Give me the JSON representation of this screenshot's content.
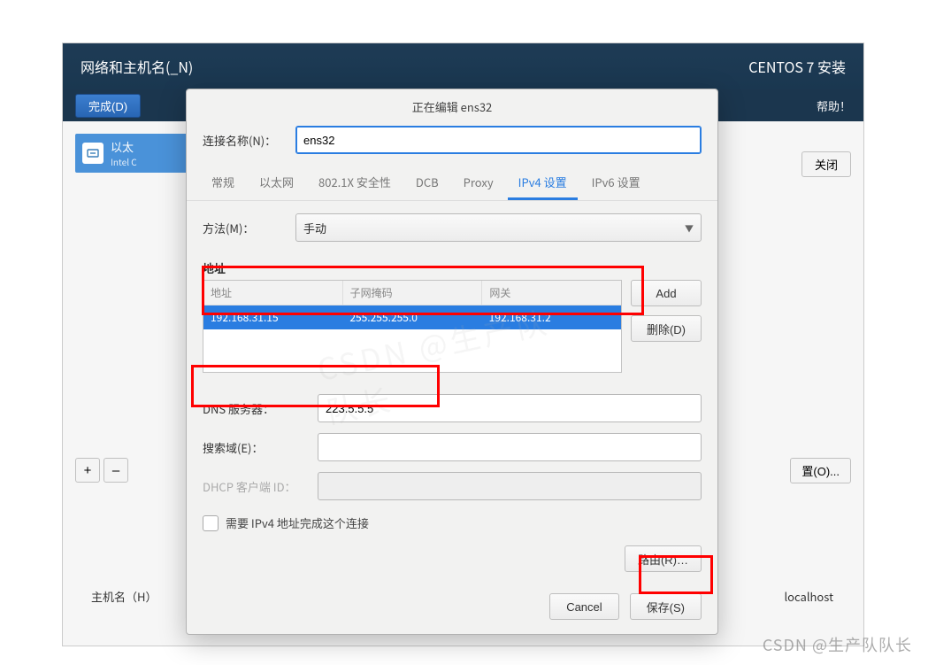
{
  "outer": {
    "title": "网络和主机名(_N)",
    "product": "CENTOS 7 安装",
    "done": "完成(D)",
    "help": "帮助！",
    "net_card_title": "以太",
    "net_card_sub": "Intel C",
    "close": "关闭",
    "plus": "+",
    "minus": "–",
    "configure": "置(O)...",
    "hostname_label": "主机名（H）",
    "localhost": "localhost"
  },
  "modal": {
    "title": "正在编辑 ens32",
    "conn_name_label": "连接名称(N)：",
    "conn_name_value": "ens32",
    "tabs": [
      "常规",
      "以太网",
      "802.1X 安全性",
      "DCB",
      "Proxy",
      "IPv4 设置",
      "IPv6 设置"
    ],
    "active_tab": 5,
    "method_label": "方法(M)：",
    "method_value": "手动",
    "address_heading": "地址",
    "table": {
      "headers": [
        "地址",
        "子网掩码",
        "网关"
      ],
      "row": [
        "192.168.31.15",
        "255.255.255.0",
        "192.168.31.2"
      ]
    },
    "add": "Add",
    "delete": "删除(D)",
    "dns_label": "DNS 服务器：",
    "dns_value": "223.5.5.5",
    "search_label": "搜索域(E)：",
    "search_value": "",
    "dhcp_label": "DHCP 客户端 ID：",
    "dhcp_value": "",
    "require_ipv4": "需要 IPv4 地址完成这个连接",
    "route": "路由(R)…",
    "cancel": "Cancel",
    "save": "保存(S)"
  },
  "watermark": "CSDN @生产队队长"
}
